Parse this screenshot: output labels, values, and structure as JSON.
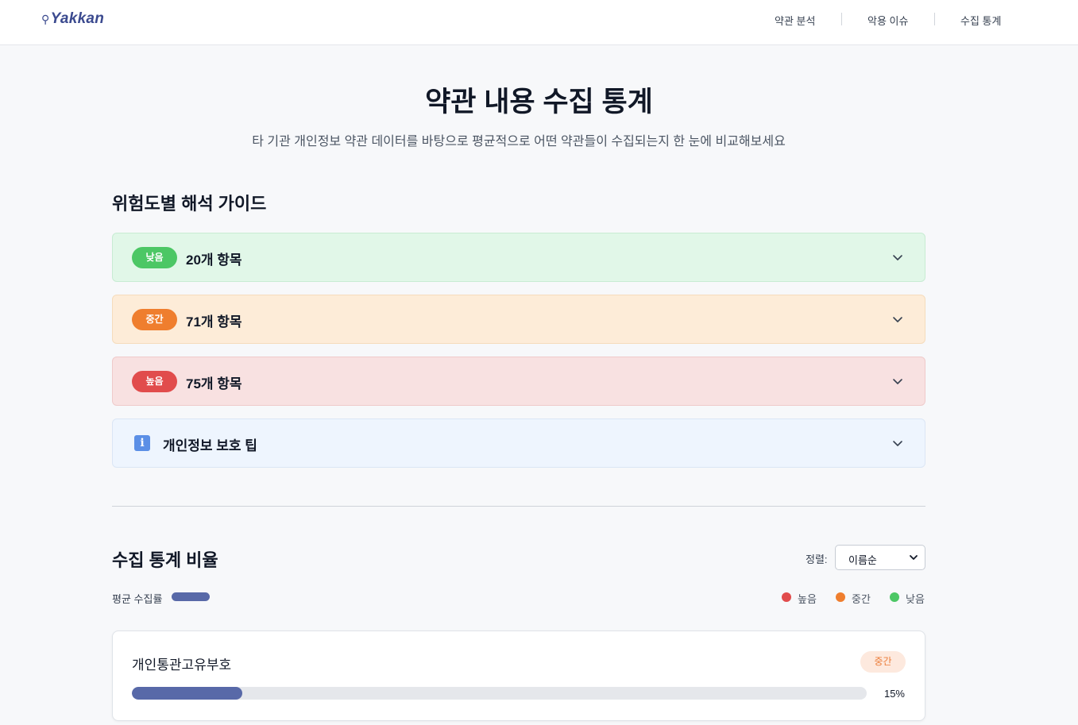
{
  "header": {
    "logo": "Yakkan",
    "nav": [
      "약관 분석",
      "악용 이슈",
      "수집 통계"
    ]
  },
  "hero": {
    "title": "약관 내용 수집 통계",
    "subtitle": "타 기관 개인정보 약관 데이터를 바탕으로 평균적으로 어떤 약관들이 수집되는지 한 눈에 비교해보세요"
  },
  "guide": {
    "title": "위험도별 해석 가이드",
    "items": [
      {
        "level": "낮음",
        "label": "20개 항목"
      },
      {
        "level": "중간",
        "label": "71개 항목"
      },
      {
        "level": "높음",
        "label": "75개 항목"
      }
    ],
    "tip": {
      "icon": "info-icon",
      "label": "개인정보 보호 팁"
    }
  },
  "stats": {
    "title": "수집 통계 비율",
    "sort_label": "정렬:",
    "sort_value": "이름순",
    "avg_label": "평균 수집률",
    "legend": [
      "높음",
      "중간",
      "낮음"
    ],
    "cards": [
      {
        "name": "개인통관고유부호",
        "level": "중간",
        "percent_label": "15%",
        "percent": 15
      }
    ]
  },
  "colors": {
    "low": "#4cc765",
    "mid": "#ef7e2e",
    "high": "#e14c4c",
    "avg_bar": "#5869a8"
  }
}
